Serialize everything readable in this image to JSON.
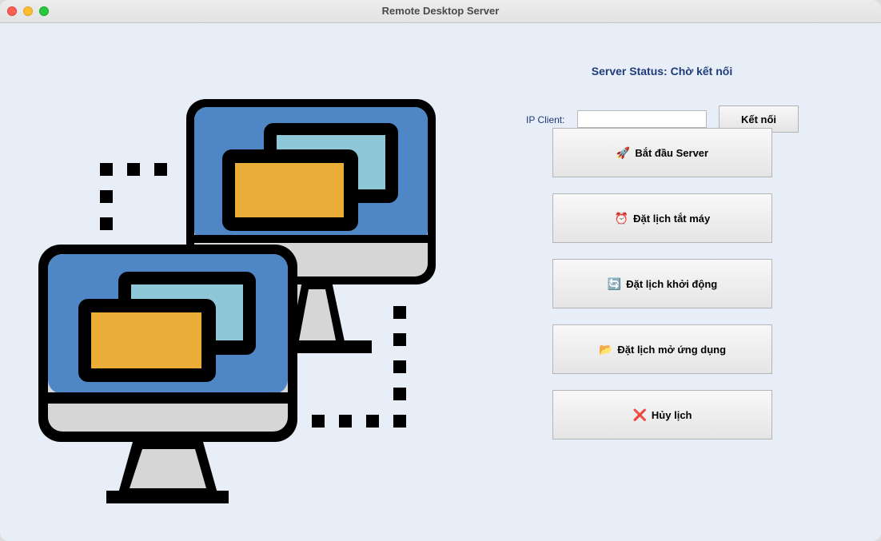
{
  "window": {
    "title": "Remote Desktop Server"
  },
  "server": {
    "status_text": "Server Status: Chờ kết nối"
  },
  "connection": {
    "ip_label": "IP Client:",
    "ip_value": "",
    "connect_label": "Kết nối"
  },
  "actions": [
    {
      "icon": "🚀",
      "icon_name": "rocket-icon",
      "label": "Bắt đầu Server"
    },
    {
      "icon": "⏰",
      "icon_name": "alarm-clock-icon",
      "label": "Đặt lịch tắt máy"
    },
    {
      "icon": "🔄",
      "icon_name": "refresh-icon",
      "label": "Đặt lịch khởi động"
    },
    {
      "icon": "📂",
      "icon_name": "folder-icon",
      "label": "Đặt lịch mở ứng dụng"
    },
    {
      "icon": "❌",
      "icon_name": "cross-mark-icon",
      "label": "Hủy lịch"
    }
  ],
  "colors": {
    "background": "#e8eef8",
    "accent_text": "#1f3b78",
    "screen_blue": "#4f86c6",
    "window_teal": "#8ec8d8",
    "window_orange": "#eaad37",
    "stand_gray": "#d6d6d6"
  }
}
